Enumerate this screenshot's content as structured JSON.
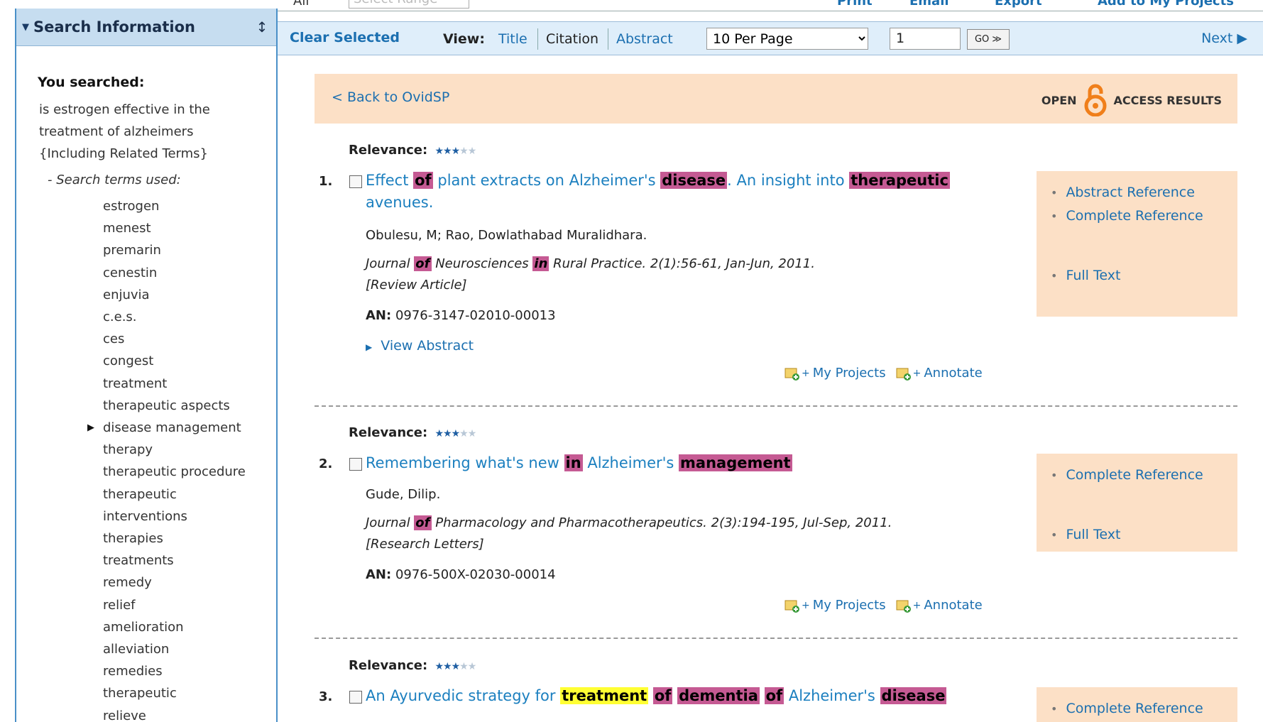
{
  "top": {
    "all_label": "All",
    "range_placeholder": "Select Range",
    "print": "Print",
    "email": "Email",
    "export": "Export",
    "add_projects": "Add to My Projects"
  },
  "sidebar": {
    "header": "Search Information",
    "you_searched": "You searched:",
    "query_lines": [
      "is estrogen effective in the",
      "treatment of alzheimers",
      "{Including Related Terms}"
    ],
    "terms_heading": "- Search terms used:",
    "terms": [
      "estrogen",
      "menest",
      "premarin",
      "cenestin",
      "enjuvia",
      "c.e.s.",
      "ces",
      "congest",
      "treatment",
      "therapeutic aspects",
      "disease management",
      "therapy",
      "therapeutic procedure",
      "therapeutic",
      "interventions",
      "therapies",
      "treatments",
      "remedy",
      "relief",
      "amelioration",
      "alleviation",
      "remedies",
      "therapeutic",
      "relieve"
    ]
  },
  "toolbar": {
    "clear_selected": "Clear Selected",
    "view_label": "View:",
    "view_title": "Title",
    "view_citation": "Citation",
    "view_abstract": "Abstract",
    "per_page": "10 Per Page",
    "page": "1",
    "go": "GO ≫",
    "next": "Next ▶"
  },
  "banner": {
    "back": "< Back to OvidSP",
    "open": "OPEN",
    "access": "ACCESS RESULTS"
  },
  "records": [
    {
      "relevance_label": "Relevance:",
      "relevance": 3,
      "num": "1.",
      "title_parts": [
        {
          "t": "Effect ",
          "h": ""
        },
        {
          "t": "of",
          "h": "m"
        },
        {
          "t": " plant extracts on Alzheimer's ",
          "h": ""
        },
        {
          "t": "disease",
          "h": "m"
        },
        {
          "t": ". An insight into ",
          "h": ""
        },
        {
          "t": "therapeutic",
          "h": "m"
        },
        {
          "t": " avenues.",
          "h": ""
        }
      ],
      "authors": "Obulesu, M; Rao, Dowlathabad Muralidhara.",
      "journal_parts": [
        {
          "t": "Journal ",
          "h": ""
        },
        {
          "t": "of",
          "h": "m"
        },
        {
          "t": " Neurosciences ",
          "h": ""
        },
        {
          "t": "in",
          "h": "m"
        },
        {
          "t": " Rural Practice. 2(1):56-61, Jan-Jun, 2011.",
          "h": ""
        }
      ],
      "pub_type": "[Review Article]",
      "an_label": "AN:",
      "an": "0976-3147-02010-00013",
      "view_abstract": "View Abstract",
      "my_projects": "My Projects",
      "annotate": "Annotate",
      "links": [
        "Abstract Reference",
        "Complete Reference",
        "",
        "Full Text"
      ]
    },
    {
      "relevance_label": "Relevance:",
      "relevance": 3,
      "num": "2.",
      "title_parts": [
        {
          "t": "Remembering what's new ",
          "h": ""
        },
        {
          "t": "in",
          "h": "m"
        },
        {
          "t": " Alzheimer's ",
          "h": ""
        },
        {
          "t": "management",
          "h": "m"
        }
      ],
      "authors": "Gude, Dilip.",
      "journal_parts": [
        {
          "t": "Journal ",
          "h": ""
        },
        {
          "t": "of",
          "h": "m"
        },
        {
          "t": " Pharmacology and Pharmacotherapeutics. 2(3):194-195, Jul-Sep, 2011.",
          "h": ""
        }
      ],
      "pub_type": "[Research Letters]",
      "an_label": "AN:",
      "an": "0976-500X-02030-00014",
      "my_projects": "My Projects",
      "annotate": "Annotate",
      "links": [
        "Complete Reference",
        "",
        "Full Text"
      ]
    },
    {
      "relevance_label": "Relevance:",
      "relevance": 3,
      "num": "3.",
      "title_parts": [
        {
          "t": "An Ayurvedic strategy for ",
          "h": ""
        },
        {
          "t": "treatment",
          "h": "y"
        },
        {
          "t": " ",
          "h": ""
        },
        {
          "t": "of",
          "h": "m"
        },
        {
          "t": " ",
          "h": ""
        },
        {
          "t": "dementia",
          "h": "m"
        },
        {
          "t": " ",
          "h": ""
        },
        {
          "t": "of",
          "h": "m"
        },
        {
          "t": " Alzheimer's ",
          "h": ""
        },
        {
          "t": "disease",
          "h": "m"
        }
      ],
      "links": [
        "Complete Reference"
      ]
    }
  ],
  "colors": {
    "link": "#1b6fb0",
    "highlight_magenta": "#c55a93",
    "highlight_yellow": "#ffff33",
    "banner_bg": "#fce0c6",
    "toolbar_bg": "#dfeefa",
    "star_on": "#1f5fa3",
    "open_access_orange": "#f07f1a"
  }
}
